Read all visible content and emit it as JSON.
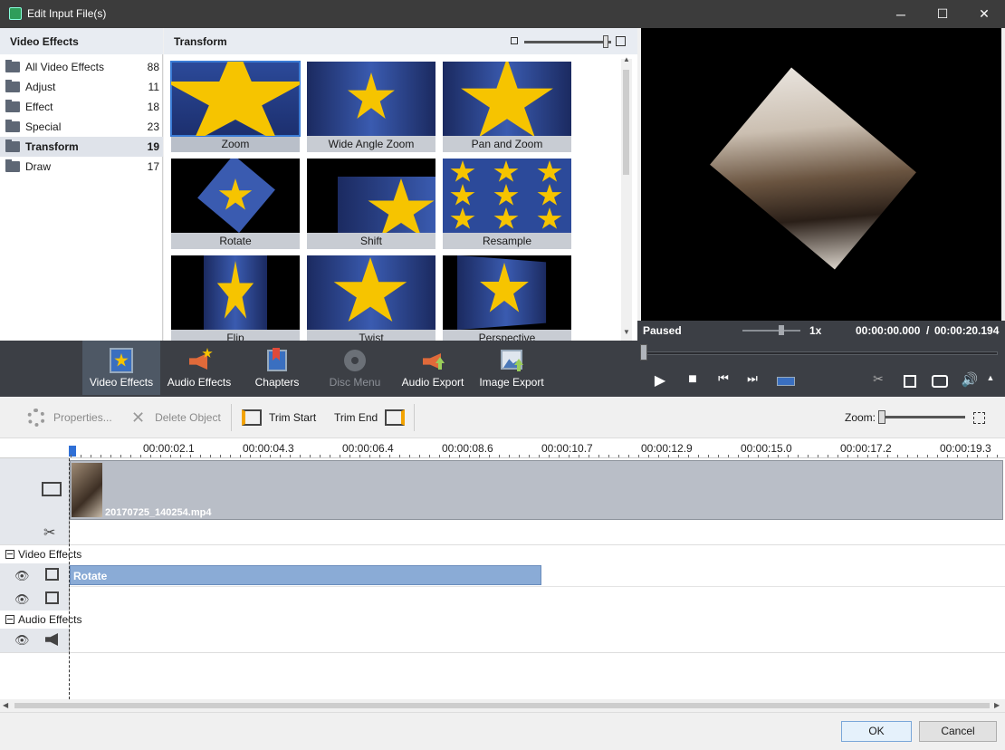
{
  "window": {
    "title": "Edit Input File(s)",
    "minimize": "─",
    "maximize": "☐",
    "close": "✕"
  },
  "categories": {
    "heading": "Video Effects",
    "items": [
      {
        "label": "All Video Effects",
        "count": "88"
      },
      {
        "label": "Adjust",
        "count": "11"
      },
      {
        "label": "Effect",
        "count": "18"
      },
      {
        "label": "Special",
        "count": "23"
      },
      {
        "label": "Transform",
        "count": "19",
        "selected": true
      },
      {
        "label": "Draw",
        "count": "17"
      }
    ]
  },
  "effects": {
    "heading": "Transform",
    "tiles": [
      {
        "label": "Zoom",
        "selected": true
      },
      {
        "label": "Wide Angle Zoom"
      },
      {
        "label": "Pan and Zoom"
      },
      {
        "label": "Rotate"
      },
      {
        "label": "Shift"
      },
      {
        "label": "Resample"
      },
      {
        "label": "Flip"
      },
      {
        "label": "Twist"
      },
      {
        "label": "Perspective"
      }
    ]
  },
  "player": {
    "status": "Paused",
    "speed": "1x",
    "time_current": "00:00:00.000",
    "time_separator": "/",
    "time_total": "00:00:20.194"
  },
  "band": {
    "buttons": [
      {
        "label": "Video Effects",
        "selected": true
      },
      {
        "label": "Audio Effects"
      },
      {
        "label": "Chapters"
      },
      {
        "label": "Disc Menu",
        "disabled": true
      },
      {
        "label": "Audio Export"
      },
      {
        "label": "Image Export"
      }
    ]
  },
  "edit_toolbar": {
    "properties": "Properties...",
    "delete_object": "Delete Object",
    "trim_start": "Trim Start",
    "trim_end": "Trim End",
    "zoom_label": "Zoom:"
  },
  "ruler": {
    "ticks": [
      "00:00:02.1",
      "00:00:04.3",
      "00:00:06.4",
      "00:00:08.6",
      "00:00:10.7",
      "00:00:12.9",
      "00:00:15.0",
      "00:00:17.2",
      "00:00:19.3"
    ]
  },
  "timeline": {
    "clip_name": "20170725_140254.mp4",
    "video_effects_section": "Video Effects",
    "audio_effects_section": "Audio Effects",
    "effect_bar_label": "Rotate"
  },
  "dialog": {
    "ok": "OK",
    "cancel": "Cancel"
  },
  "colors": {
    "accent": "#3a7bd5",
    "band": "#3c3f45",
    "effect_bar": "#8aabd6",
    "clip": "#b9bec7"
  }
}
